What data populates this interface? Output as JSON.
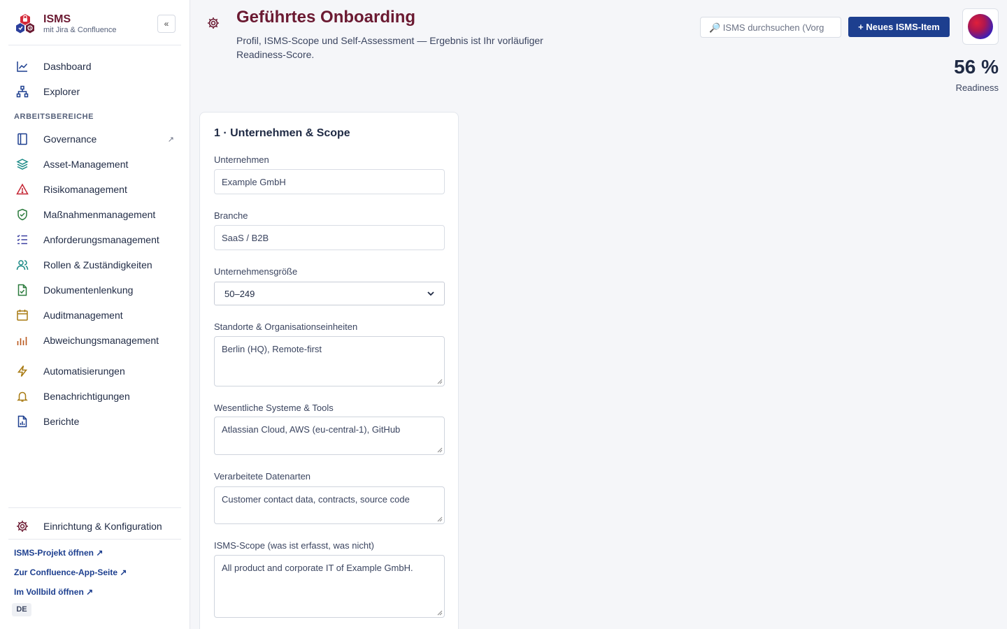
{
  "brand": {
    "name": "ISMS",
    "subtitle": "mit Jira & Confluence",
    "collapse": "«"
  },
  "sidebar": {
    "top_items": [
      {
        "label": "Dashboard",
        "icon": "chart-line-icon"
      },
      {
        "label": "Explorer",
        "icon": "hierarchy-icon"
      }
    ],
    "section_label": "ARBEITSBEREICHE",
    "work_items": [
      {
        "label": "Governance",
        "icon": "book-icon",
        "external": "↗"
      },
      {
        "label": "Asset-Management",
        "icon": "layers-icon"
      },
      {
        "label": "Risikomanagement",
        "icon": "warning-icon"
      },
      {
        "label": "Maßnahmenmanagement",
        "icon": "shield-check-icon"
      },
      {
        "label": "Anforderungsmanagement",
        "icon": "checklist-icon"
      },
      {
        "label": "Rollen & Zuständigkeiten",
        "icon": "users-icon"
      },
      {
        "label": "Dokumentenlenkung",
        "icon": "file-check-icon"
      },
      {
        "label": "Auditmanagement",
        "icon": "calendar-icon"
      },
      {
        "label": "Abweichungsmanagement",
        "icon": "bar-chart-icon"
      }
    ],
    "tool_items": [
      {
        "label": "Automatisierungen",
        "icon": "bolt-icon"
      },
      {
        "label": "Benachrichtigungen",
        "icon": "bell-icon"
      },
      {
        "label": "Berichte",
        "icon": "report-icon"
      }
    ],
    "settings_item": {
      "label": "Einrichtung & Konfiguration",
      "icon": "gear-icon"
    },
    "footer_links": [
      "ISMS-Projekt öffnen ↗",
      "Zur Confluence-App-Seite ↗",
      "Im Vollbild öffnen ↗"
    ],
    "language": "DE"
  },
  "header": {
    "title": "Geführtes Onboarding",
    "subtitle": "Profil, ISMS-Scope und Self-Assessment — Ergebnis ist Ihr vorläufiger Readiness-Score.",
    "search_placeholder": "🔎 ISMS durchsuchen (Vorg",
    "new_button": "+ Neues ISMS-Item",
    "readiness_value": "56 %",
    "readiness_label": "Readiness"
  },
  "form": {
    "title": "1 · Unternehmen & Scope",
    "company_label": "Unternehmen",
    "company_value": "Example GmbH",
    "industry_label": "Branche",
    "industry_value": "SaaS / B2B",
    "size_label": "Unternehmensgröße",
    "size_value": "50–249",
    "locations_label": "Standorte & Organisationseinheiten",
    "locations_value": "Berlin (HQ), Remote-first",
    "systems_label": "Wesentliche Systeme & Tools",
    "systems_value": "Atlassian Cloud, AWS (eu-central-1), GitHub",
    "data_label": "Verarbeitete Datenarten",
    "data_value": "Customer contact data, contracts, source code",
    "scope_label": "ISMS-Scope (was ist erfasst, was nicht)",
    "scope_value": "All product and corporate IT of Example GmbH."
  },
  "colors": {
    "brand": "#6b1a32",
    "primary": "#1d3f8f"
  }
}
